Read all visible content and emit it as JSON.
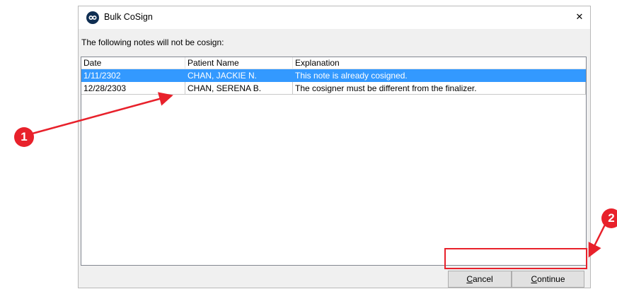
{
  "dialog": {
    "title": "Bulk CoSign",
    "close_glyph": "✕",
    "message": "The following notes will not be cosign:"
  },
  "table": {
    "columns": [
      "Date",
      "Patient Name",
      "Explanation"
    ],
    "rows": [
      {
        "date": "1/11/2302",
        "patient": "CHAN, JACKIE N.",
        "explanation": "This note is already cosigned.",
        "selected": true
      },
      {
        "date": "12/28/2303",
        "patient": "CHAN, SERENA B.",
        "explanation": "The cosigner must be different from the finalizer.",
        "selected": false
      }
    ]
  },
  "buttons": {
    "cancel_mnemonic": "C",
    "cancel_rest": "ancel",
    "continue_mnemonic": "C",
    "continue_rest": "ontinue"
  },
  "annotations": {
    "badge1": "1",
    "badge2": "2",
    "color": "#e8212b"
  },
  "colors": {
    "selection": "#3399ff",
    "app_icon": "#0f2e52"
  },
  "icons": {
    "app": "app-logo-icon",
    "close": "close-icon"
  }
}
